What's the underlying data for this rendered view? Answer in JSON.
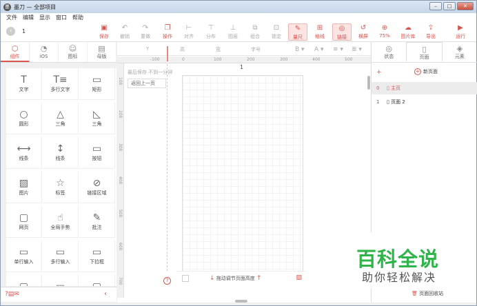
{
  "window": {
    "title": "墨刀 — 全部项目",
    "app_icon": "墨"
  },
  "menu": [
    "文件",
    "编辑",
    "显示",
    "窗口",
    "帮助"
  ],
  "toolbar": {
    "page_number": "1",
    "items": [
      {
        "label": "保存",
        "icon": "save-icon",
        "state": "active"
      },
      {
        "label": "撤销",
        "icon": "undo-icon",
        "state": "disabled"
      },
      {
        "label": "重做",
        "icon": "redo-icon",
        "state": "disabled"
      },
      {
        "label": "操作",
        "icon": "operate-icon",
        "state": "active"
      },
      {
        "label": "对齐",
        "icon": "align-icon",
        "state": "disabled"
      },
      {
        "label": "分布",
        "icon": "distribute-icon",
        "state": "disabled"
      },
      {
        "label": "图层",
        "icon": "layer-icon",
        "state": "disabled"
      },
      {
        "label": "组合",
        "icon": "group-icon",
        "state": "disabled"
      },
      {
        "label": "锁定",
        "icon": "lock-icon",
        "state": "disabled"
      },
      {
        "label": "量尺",
        "icon": "ruler-icon",
        "state": "selected"
      },
      {
        "label": "格线",
        "icon": "grid-icon",
        "state": "active"
      },
      {
        "label": "链接",
        "icon": "link-icon",
        "state": "active"
      },
      {
        "label": "横屏",
        "icon": "rotate-icon",
        "state": "active"
      },
      {
        "label": "75%",
        "icon": "zoom-icon",
        "state": "active"
      },
      {
        "label": "图片库",
        "icon": "image-library-icon",
        "state": "active"
      },
      {
        "label": "导出",
        "icon": "export-icon",
        "state": "active"
      },
      {
        "label": "运行",
        "icon": "run-icon",
        "state": "active"
      }
    ]
  },
  "left_tabs": [
    {
      "label": "组件",
      "icon": "cube-icon",
      "active": true
    },
    {
      "label": "iOS",
      "icon": "apple-icon",
      "active": false
    },
    {
      "label": "图标",
      "icon": "smile-icon",
      "active": false
    },
    {
      "label": "母版",
      "icon": "master-icon",
      "active": false
    }
  ],
  "components": [
    {
      "label": "文字",
      "glyph": "T"
    },
    {
      "label": "多行文字",
      "glyph": "T≡"
    },
    {
      "label": "矩形",
      "glyph": "▭"
    },
    {
      "label": "圆形",
      "glyph": "○"
    },
    {
      "label": "三角",
      "glyph": "△"
    },
    {
      "label": "三角",
      "glyph": "◺"
    },
    {
      "label": "线条",
      "glyph": "⟷"
    },
    {
      "label": "线条",
      "glyph": "↕"
    },
    {
      "label": "按钮",
      "glyph": "▭"
    },
    {
      "label": "图片",
      "glyph": "▨"
    },
    {
      "label": "标签",
      "glyph": "☆"
    },
    {
      "label": "链接区域",
      "glyph": "⊘"
    },
    {
      "label": "网页",
      "glyph": "▢"
    },
    {
      "label": "全局手势",
      "glyph": "☝"
    },
    {
      "label": "批注",
      "glyph": "✎"
    },
    {
      "label": "单行输入",
      "glyph": "▭"
    },
    {
      "label": "多行输入",
      "glyph": "▭"
    },
    {
      "label": "下拉框",
      "glyph": "▭"
    },
    {
      "label": "",
      "glyph": "▢"
    },
    {
      "label": "",
      "glyph": "▭"
    },
    {
      "label": "",
      "glyph": "▢"
    }
  ],
  "props": {
    "y": "Y",
    "height": "高",
    "width": "宽",
    "font_size": "字号"
  },
  "ruler_h": [
    "-100",
    "0",
    "100",
    "200",
    "300",
    "400",
    "500"
  ],
  "ruler_v": [
    "100",
    "200",
    "300",
    "400",
    "500",
    "600",
    "700"
  ],
  "canvas": {
    "page_label": "1",
    "hint": "最后保存 不到一分钟",
    "back_button": "返回上一页",
    "drag_hint": "拖动调节页面高度"
  },
  "right_tabs": [
    {
      "label": "状态",
      "icon": "status-icon",
      "active": false
    },
    {
      "label": "页面",
      "icon": "page-icon",
      "active": true
    },
    {
      "label": "元素",
      "icon": "layers-icon",
      "active": false
    }
  ],
  "pages": {
    "new_label": "新页面",
    "rows": [
      {
        "index": "0",
        "name": "主页",
        "selected": true
      },
      {
        "index": "1",
        "name": "页面 2",
        "selected": false
      }
    ],
    "recycle": "页面回收站"
  },
  "watermark": {
    "line1": "百科全说",
    "line2": "助你轻松解决"
  }
}
